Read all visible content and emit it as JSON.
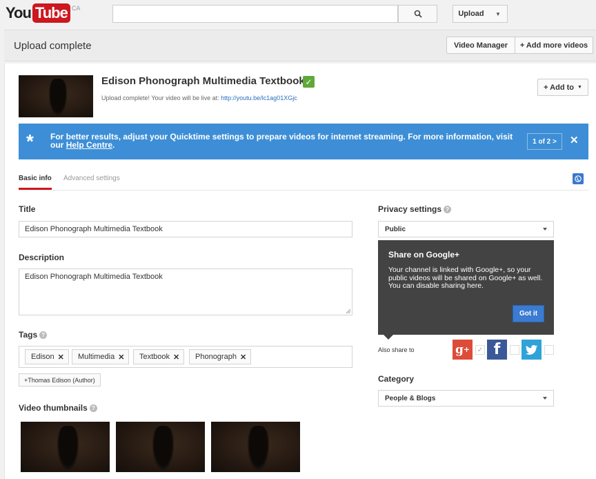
{
  "masthead": {
    "logo_you": "You",
    "logo_tube": "Tube",
    "region": "CA",
    "search_value": "",
    "upload_label": "Upload"
  },
  "subheader": {
    "title": "Upload complete",
    "video_manager": "Video Manager",
    "add_more": "+ Add more videos"
  },
  "video": {
    "title": "Edison Phonograph Multimedia Textbook",
    "status_prefix": "Upload complete! Your video will be live at:",
    "url": "http://youtu.be/lc1ag01XGjc",
    "add_to": "+ Add to"
  },
  "banner": {
    "message": "For better results, adjust your Quicktime settings to prepare videos for internet streaming. For more information, visit our",
    "link": "Help Centre",
    "suffix": ".",
    "pager": "1 of 2 >",
    "close": "✕"
  },
  "tabs": {
    "basic": "Basic info",
    "advanced": "Advanced settings"
  },
  "form": {
    "title_label": "Title",
    "title_value": "Edison Phonograph Multimedia Textbook",
    "description_label": "Description",
    "description_value": "Edison Phonograph Multimedia Textbook",
    "tags_label": "Tags",
    "tags": [
      "Edison",
      "Multimedia",
      "Textbook",
      "Phonograph"
    ],
    "suggested_tag": "+Thomas Edison (Author)",
    "thumbnails_label": "Video thumbnails"
  },
  "privacy": {
    "label": "Privacy settings",
    "value": "Public"
  },
  "gplus_popup": {
    "heading": "Share on Google+",
    "body": "Your channel is linked with Google+, so your public videos will be shared on Google+ as well. You can disable sharing here.",
    "button": "Got it"
  },
  "share": {
    "label": "Also share to"
  },
  "category": {
    "label": "Category",
    "value": "People & Blogs"
  },
  "colors": {
    "brand_red": "#cc181e",
    "banner_blue": "#3d8ed6",
    "gplus_red": "#dd4b39",
    "facebook_blue": "#3b5998",
    "twitter_blue": "#2fa3d9",
    "verified_green": "#5fa93a"
  }
}
